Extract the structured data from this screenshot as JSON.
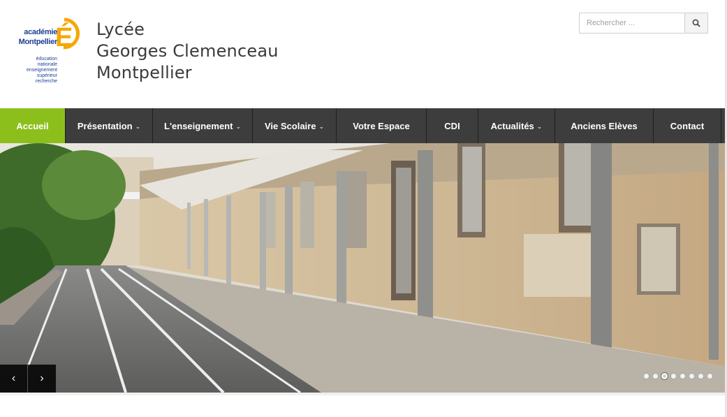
{
  "logo": {
    "line1": "académie",
    "line2": "Montpellier",
    "letter": "É",
    "sub": [
      "éducation",
      "nationale",
      "enseignement",
      "supérieur",
      "recherche"
    ],
    "accent_color": "#f5a800",
    "text_color": "#1d3f94"
  },
  "site_title": {
    "line1": "Lycée",
    "line2": "Georges Clemenceau",
    "line3": "Montpellier"
  },
  "search": {
    "placeholder": "Rechercher ...",
    "button_icon": "search-icon"
  },
  "nav": {
    "accent_color": "#8cbf1c",
    "items": [
      {
        "label": "Accueil",
        "chevron": "",
        "active": true
      },
      {
        "label": "Présentation",
        "chevron": "⌄"
      },
      {
        "label": "L'enseignement",
        "chevron": "⌄"
      },
      {
        "label": "Vie Scolaire",
        "chevron": "⌄"
      },
      {
        "label": "Votre Espace",
        "chevron": ""
      },
      {
        "label": "CDI",
        "chevron": ""
      },
      {
        "label": "Actualités",
        "chevron": "⌄"
      },
      {
        "label": "Anciens Elèves",
        "chevron": ""
      },
      {
        "label": "Contact",
        "chevron": ""
      }
    ]
  },
  "slider": {
    "prev_icon": "‹",
    "next_icon": "›",
    "slide_count": 8,
    "active_slide": 3
  }
}
